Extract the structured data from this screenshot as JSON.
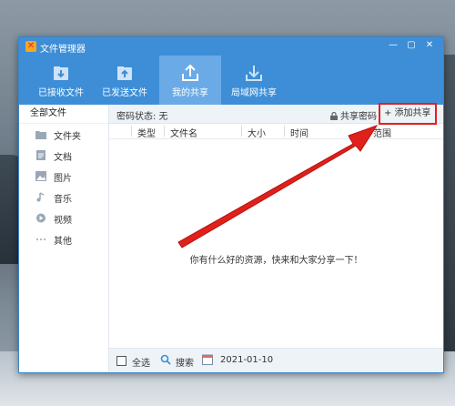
{
  "window": {
    "title": "文件管理器",
    "controls": {
      "minimize": "—",
      "maximize": "▢",
      "close": "✕"
    }
  },
  "toolbar": {
    "items": [
      {
        "label": "已接收文件",
        "icon": "inbox-download-icon"
      },
      {
        "label": "已发送文件",
        "icon": "folder-upload-icon"
      },
      {
        "label": "我的共享",
        "icon": "share-upload-icon",
        "active": true
      },
      {
        "label": "局域网共享",
        "icon": "lan-download-icon"
      }
    ]
  },
  "sidebar": {
    "header": "全部文件",
    "items": [
      {
        "label": "文件夹",
        "icon": "folder-icon"
      },
      {
        "label": "文档",
        "icon": "document-icon"
      },
      {
        "label": "图片",
        "icon": "image-icon"
      },
      {
        "label": "音乐",
        "icon": "music-icon"
      },
      {
        "label": "视频",
        "icon": "video-icon"
      },
      {
        "label": "其他",
        "icon": "more-icon"
      }
    ]
  },
  "main": {
    "password_status": "密码状态: 无",
    "share_password": "共享密码",
    "add_share": "+ 添加共享",
    "columns": [
      "类型",
      "文件名",
      "大小",
      "时间",
      "范围"
    ],
    "empty_message": "你有什么好的资源，快来和大家分享一下！"
  },
  "bottom": {
    "select_all": "全选",
    "search": "搜索",
    "date": "2021-01-10"
  },
  "colors": {
    "accent": "#3d8ed6",
    "active_tab": "#6aaae6",
    "highlight_box": "#e0201a",
    "arrow": "#e0201a"
  }
}
